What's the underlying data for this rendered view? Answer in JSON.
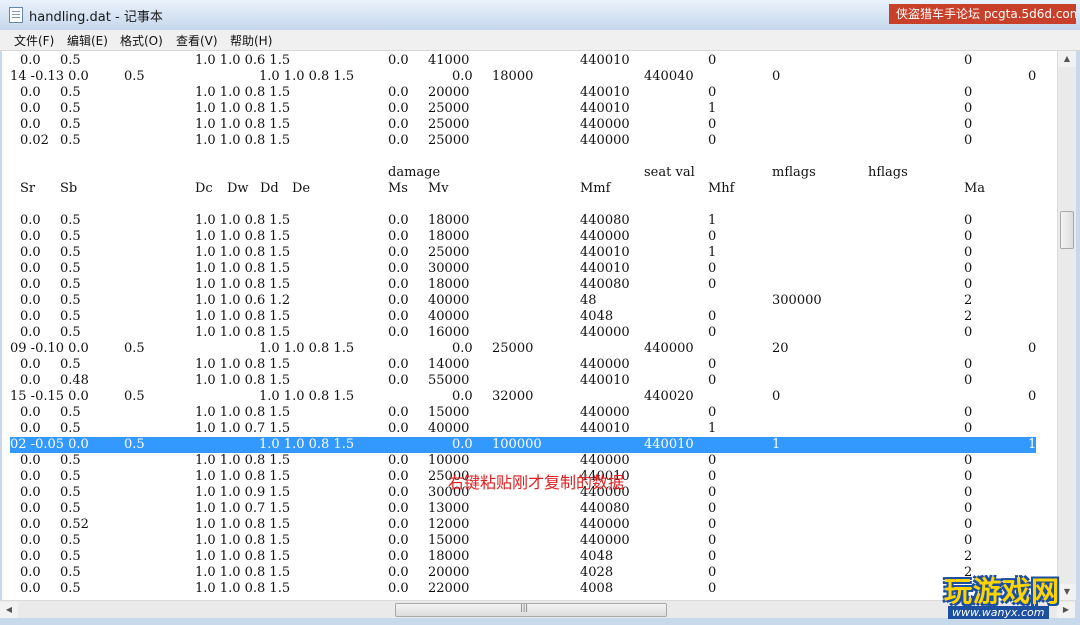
{
  "window": {
    "title": "handling.dat - 记事本"
  },
  "watermark": "侠盗猎车手论坛 pcgta.5d6d.com",
  "menu": [
    "文件(F)",
    "编辑(E)",
    "格式(O)",
    "查看(V)",
    "帮助(H)"
  ],
  "overlay_text": "右键粘贴刚才复制的数据",
  "logo": {
    "main": "玩游戏网",
    "sub": "www.wanyx.com"
  },
  "lines": [
    [
      "0.0",
      "0.5",
      "1.0 1.0 0.6 1.5",
      "0.0",
      "41000",
      "",
      "440010",
      "",
      "0",
      "",
      "0",
      ""
    ],
    [
      "14 -0.13 0.0",
      "0.5",
      "",
      "1.0 1.0 0.8 1.5",
      "0.0",
      "18000",
      "",
      "440040",
      "0",
      "",
      "0"
    ],
    [
      "0.0",
      "0.5",
      "1.0 1.0 0.8 1.5",
      "0.0",
      "20000",
      "",
      "440010",
      "",
      "0",
      "",
      "0",
      ""
    ],
    [
      "0.0",
      "0.5",
      "1.0 1.0 0.8 1.5",
      "0.0",
      "25000",
      "",
      "440010",
      "",
      "1",
      "",
      "0",
      ""
    ],
    [
      "0.0",
      "0.5",
      "1.0 1.0 0.8 1.5",
      "0.0",
      "25000",
      "",
      "440000",
      "",
      "0",
      "",
      "0",
      ""
    ],
    [
      "0.02",
      "0.5",
      "1.0 1.0 0.8 1.5",
      "0.0",
      "25000",
      "",
      "440000",
      "",
      "0",
      "",
      "0",
      ""
    ]
  ],
  "header1": {
    "damage": "damage",
    "seat_val": "seat val",
    "mflags": "mflags",
    "hflags": "hflags"
  },
  "header2": {
    "Sr": "Sr",
    "Sb": "Sb",
    "Dc": "Dc",
    "Dw": "Dw",
    "Dd": "Dd",
    "De": "De",
    "Ms": "Ms",
    "Mv": "Mv",
    "Mmf": "Mmf",
    "Mhf": "Mhf",
    "Ma": "Ma"
  },
  "rows": [
    {
      "a": "0.0",
      "b": "0.5",
      "c": "1.0 1.0 0.8 1.5",
      "d": "0.0",
      "e": "18000",
      "f": "440080",
      "g": "1",
      "h": "",
      "i": "0"
    },
    {
      "a": "0.0",
      "b": "0.5",
      "c": "1.0 1.0 0.8 1.5",
      "d": "0.0",
      "e": "18000",
      "f": "440000",
      "g": "0",
      "h": "",
      "i": "0"
    },
    {
      "a": "0.0",
      "b": "0.5",
      "c": "1.0 1.0 0.8 1.5",
      "d": "0.0",
      "e": "25000",
      "f": "440010",
      "g": "1",
      "h": "",
      "i": "0"
    },
    {
      "a": "0.0",
      "b": "0.5",
      "c": "1.0 1.0 0.8 1.5",
      "d": "0.0",
      "e": "30000",
      "f": "440010",
      "g": "0",
      "h": "",
      "i": "0"
    },
    {
      "a": "0.0",
      "b": "0.5",
      "c": "1.0 1.0 0.8 1.5",
      "d": "0.0",
      "e": "18000",
      "f": "440080",
      "g": "0",
      "h": "",
      "i": "0"
    },
    {
      "a": "0.0",
      "b": "0.5",
      "c": "1.0 1.0 0.6 1.2",
      "d": "0.0",
      "e": "40000",
      "f": "48",
      "g": "",
      "h": "300000",
      "i": "2"
    },
    {
      "a": "0.0",
      "b": "0.5",
      "c": "1.0 1.0 0.8 1.5",
      "d": "0.0",
      "e": "40000",
      "f": "4048",
      "g": "0",
      "h": "",
      "i": "2"
    },
    {
      "a": "0.0",
      "b": "0.5",
      "c": "1.0 1.0 0.8 1.5",
      "d": "0.0",
      "e": "16000",
      "f": "440000",
      "g": "0",
      "h": "",
      "i": "0"
    },
    {
      "shift": true,
      "a": "09 -0.10 0.0",
      "b": "0.5",
      "c": "1.0 1.0 0.8 1.5",
      "d": "0.0",
      "e": "25000",
      "f": "440000",
      "g": "",
      "h": "20",
      "i": "0"
    },
    {
      "a": "0.0",
      "b": "0.5",
      "c": "1.0 1.0 0.8 1.5",
      "d": "0.0",
      "e": "14000",
      "f": "440000",
      "g": "0",
      "h": "",
      "i": "0"
    },
    {
      "a": "0.0",
      "b": "0.48",
      "c": "1.0 1.0 0.8 1.5",
      "d": "0.0",
      "e": "55000",
      "f": "440010",
      "g": "0",
      "h": "",
      "i": "0"
    },
    {
      "shift": true,
      "a": "15 -0.15 0.0",
      "b": "0.5",
      "c": "1.0 1.0 0.8 1.5",
      "d": "0.0",
      "e": "32000",
      "f": "440020",
      "g": "",
      "h": "0",
      "i": "0"
    },
    {
      "a": "0.0",
      "b": "0.5",
      "c": "1.0 1.0 0.8 1.5",
      "d": "0.0",
      "e": "15000",
      "f": "440000",
      "g": "0",
      "h": "",
      "i": "0"
    },
    {
      "a": "0.0",
      "b": "0.5",
      "c": "1.0 1.0 0.7 1.5",
      "d": "0.0",
      "e": "40000",
      "f": "440010",
      "g": "1",
      "h": "",
      "i": "0"
    },
    {
      "shift": true,
      "sel": true,
      "a": "02 -0.05 0.0",
      "b": "0.5",
      "c": "1.0 1.0 0.8 1.5",
      "d": "0.0",
      "e": "100000",
      "f": "440010",
      "g": "",
      "h": "1",
      "i": "1"
    },
    {
      "a": "0.0",
      "b": "0.5",
      "c": "1.0 1.0 0.8 1.5",
      "d": "0.0",
      "e": "10000",
      "f": "440000",
      "g": "0",
      "h": "",
      "i": "0"
    },
    {
      "a": "0.0",
      "b": "0.5",
      "c": "1.0 1.0 0.8 1.5",
      "d": "0.0",
      "e": "25000",
      "f": "440010",
      "g": "0",
      "h": "",
      "i": "0"
    },
    {
      "a": "0.0",
      "b": "0.5",
      "c": "1.0 1.0 0.9 1.5",
      "d": "0.0",
      "e": "30000",
      "f": "440000",
      "g": "0",
      "h": "",
      "i": "0"
    },
    {
      "a": "0.0",
      "b": "0.5",
      "c": "1.0 1.0 0.7 1.5",
      "d": "0.0",
      "e": "13000",
      "f": "440080",
      "g": "0",
      "h": "",
      "i": "0"
    },
    {
      "a": "0.0",
      "b": "0.52",
      "c": "1.0 1.0 0.8 1.5",
      "d": "0.0",
      "e": "12000",
      "f": "440000",
      "g": "0",
      "h": "",
      "i": "0"
    },
    {
      "a": "0.0",
      "b": "0.5",
      "c": "1.0 1.0 0.8 1.5",
      "d": "0.0",
      "e": "15000",
      "f": "440000",
      "g": "0",
      "h": "",
      "i": "0"
    },
    {
      "a": "0.0",
      "b": "0.5",
      "c": "1.0 1.0 0.8 1.5",
      "d": "0.0",
      "e": "18000",
      "f": "4048",
      "g": "0",
      "h": "",
      "i": "2"
    },
    {
      "a": "0.0",
      "b": "0.5",
      "c": "1.0 1.0 0.8 1.5",
      "d": "0.0",
      "e": "20000",
      "f": "4028",
      "g": "0",
      "h": "",
      "i": "2"
    },
    {
      "a": "0.0",
      "b": "0.5",
      "c": "1.0 1.0 0.8 1.5",
      "d": "0.0",
      "e": "22000",
      "f": "4008",
      "g": "0",
      "h": "",
      "i": ""
    }
  ],
  "colors": {
    "selection": "#3399ff",
    "overlay_text": "#e02020",
    "watermark": "#c8402a"
  }
}
